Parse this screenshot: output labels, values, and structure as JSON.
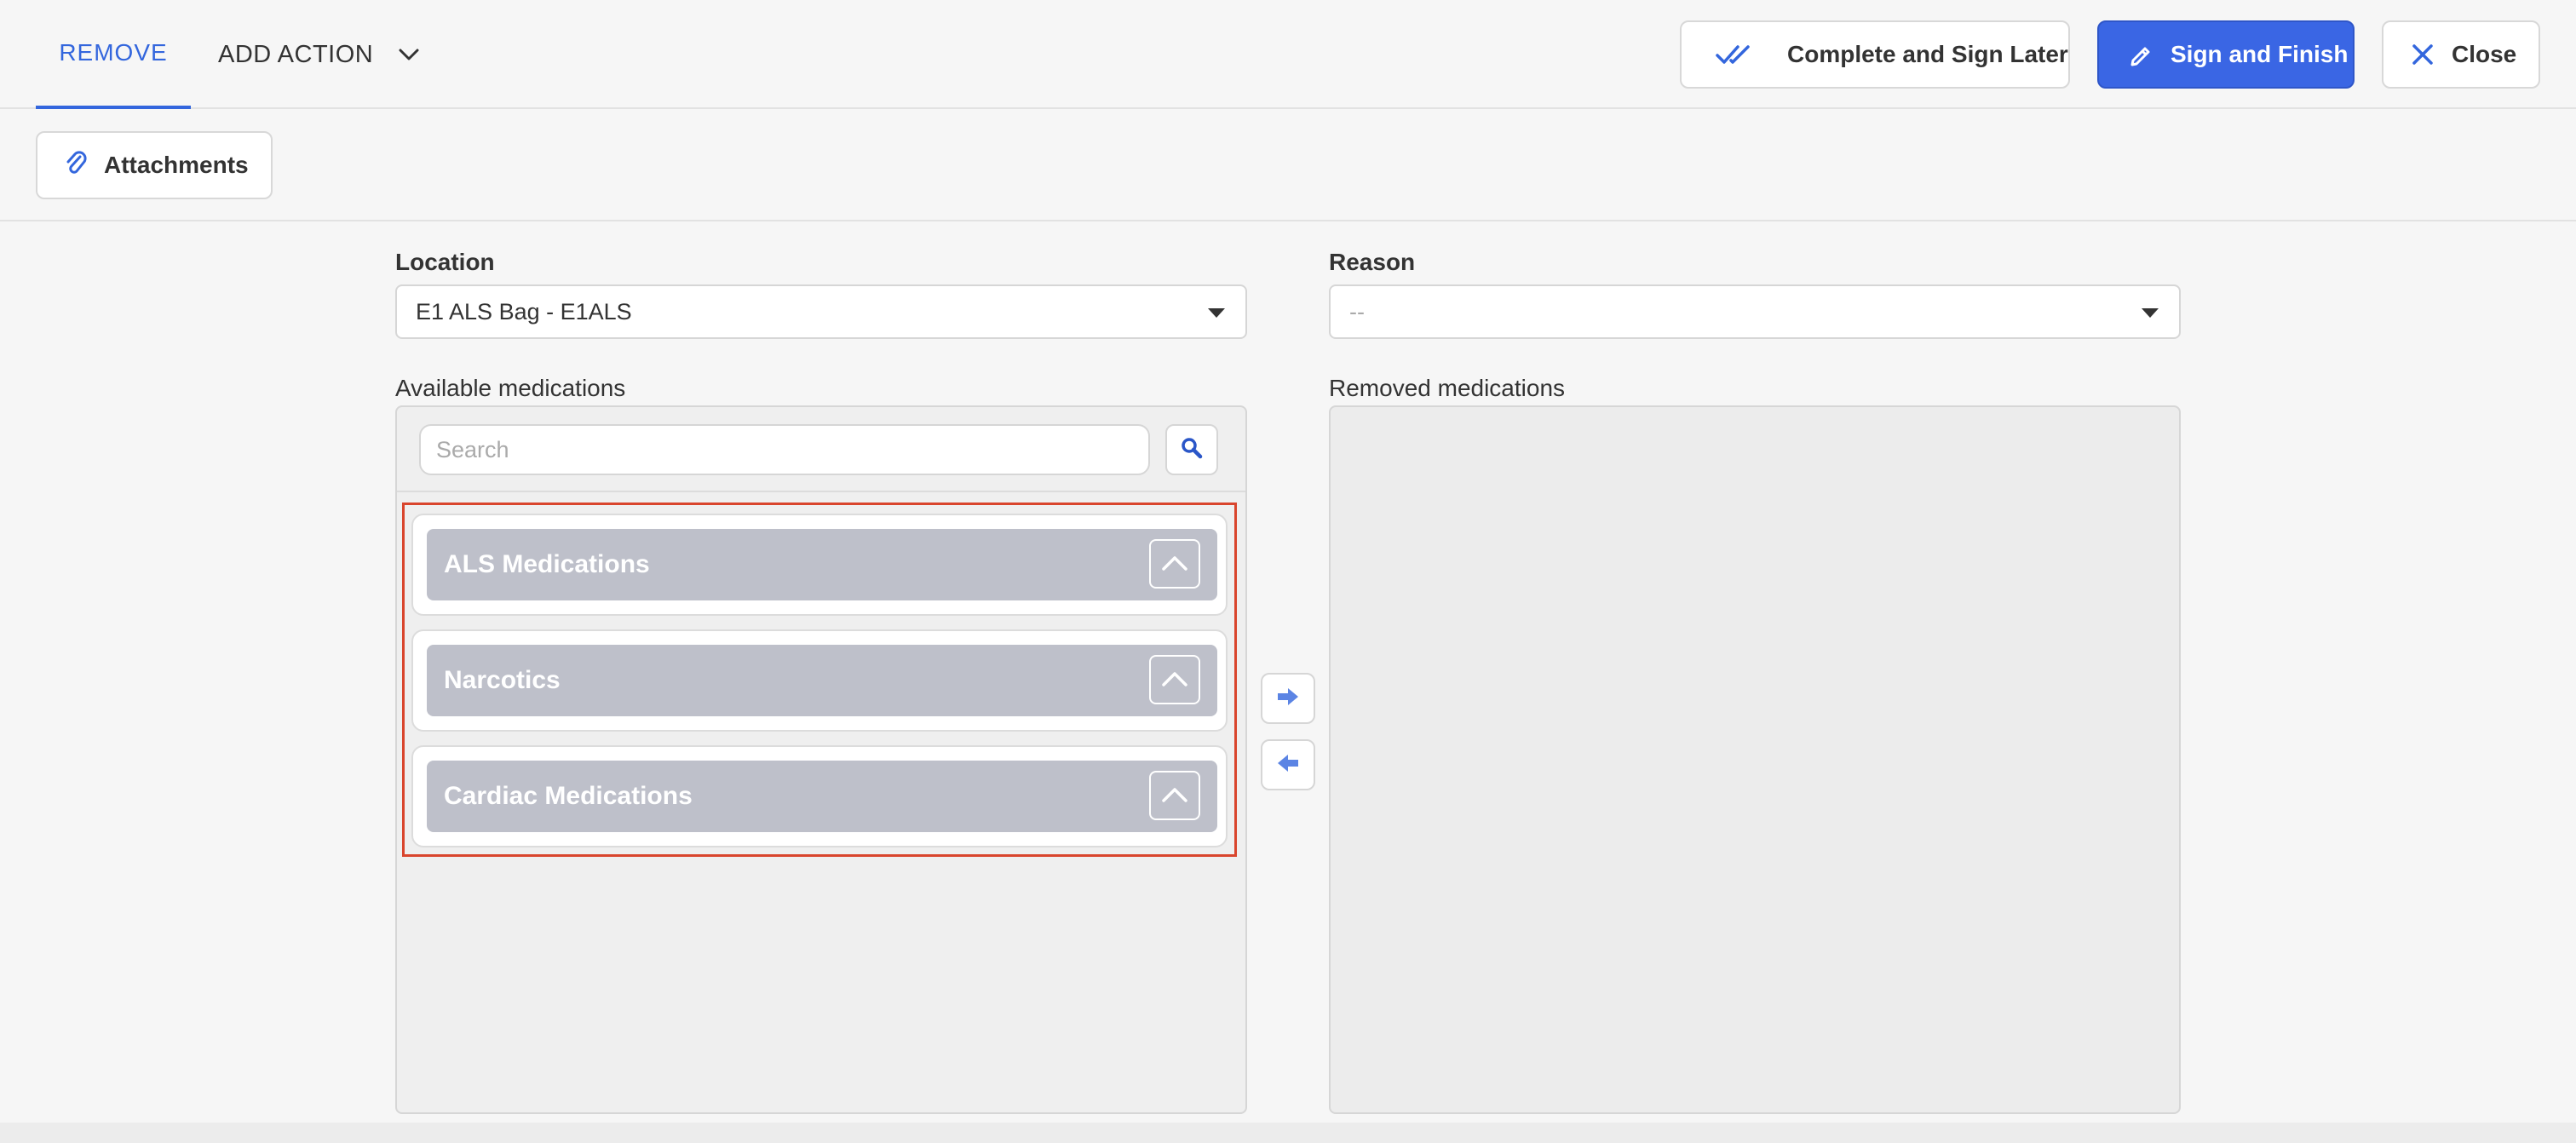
{
  "header": {
    "tab_remove": "REMOVE",
    "add_action": "ADD ACTION",
    "complete_later": "Complete and Sign Later",
    "sign_finish": "Sign and Finish",
    "close": "Close"
  },
  "toolbar": {
    "attachments": "Attachments"
  },
  "form": {
    "location_label": "Location",
    "location_value": "E1 ALS Bag - E1ALS",
    "reason_label": "Reason",
    "reason_value": "--",
    "available_label": "Available medications",
    "removed_label": "Removed medications",
    "search_placeholder": "Search"
  },
  "groups": [
    {
      "name": "ALS Medications"
    },
    {
      "name": "Narcotics"
    },
    {
      "name": "Cardiac Medications"
    }
  ],
  "colors": {
    "accent": "#3366dd",
    "primary_button": "#3a66e4",
    "group_header": "#bec0ca",
    "highlight_border": "#d9452d"
  },
  "icons": {
    "double_check": "double-check-icon",
    "pen": "pen-icon",
    "close": "close-icon",
    "paperclip": "paperclip-icon",
    "search": "search-icon",
    "move_right": "arrow-right-icon",
    "move_left": "arrow-left-icon",
    "collapse": "chevron-up-icon"
  }
}
